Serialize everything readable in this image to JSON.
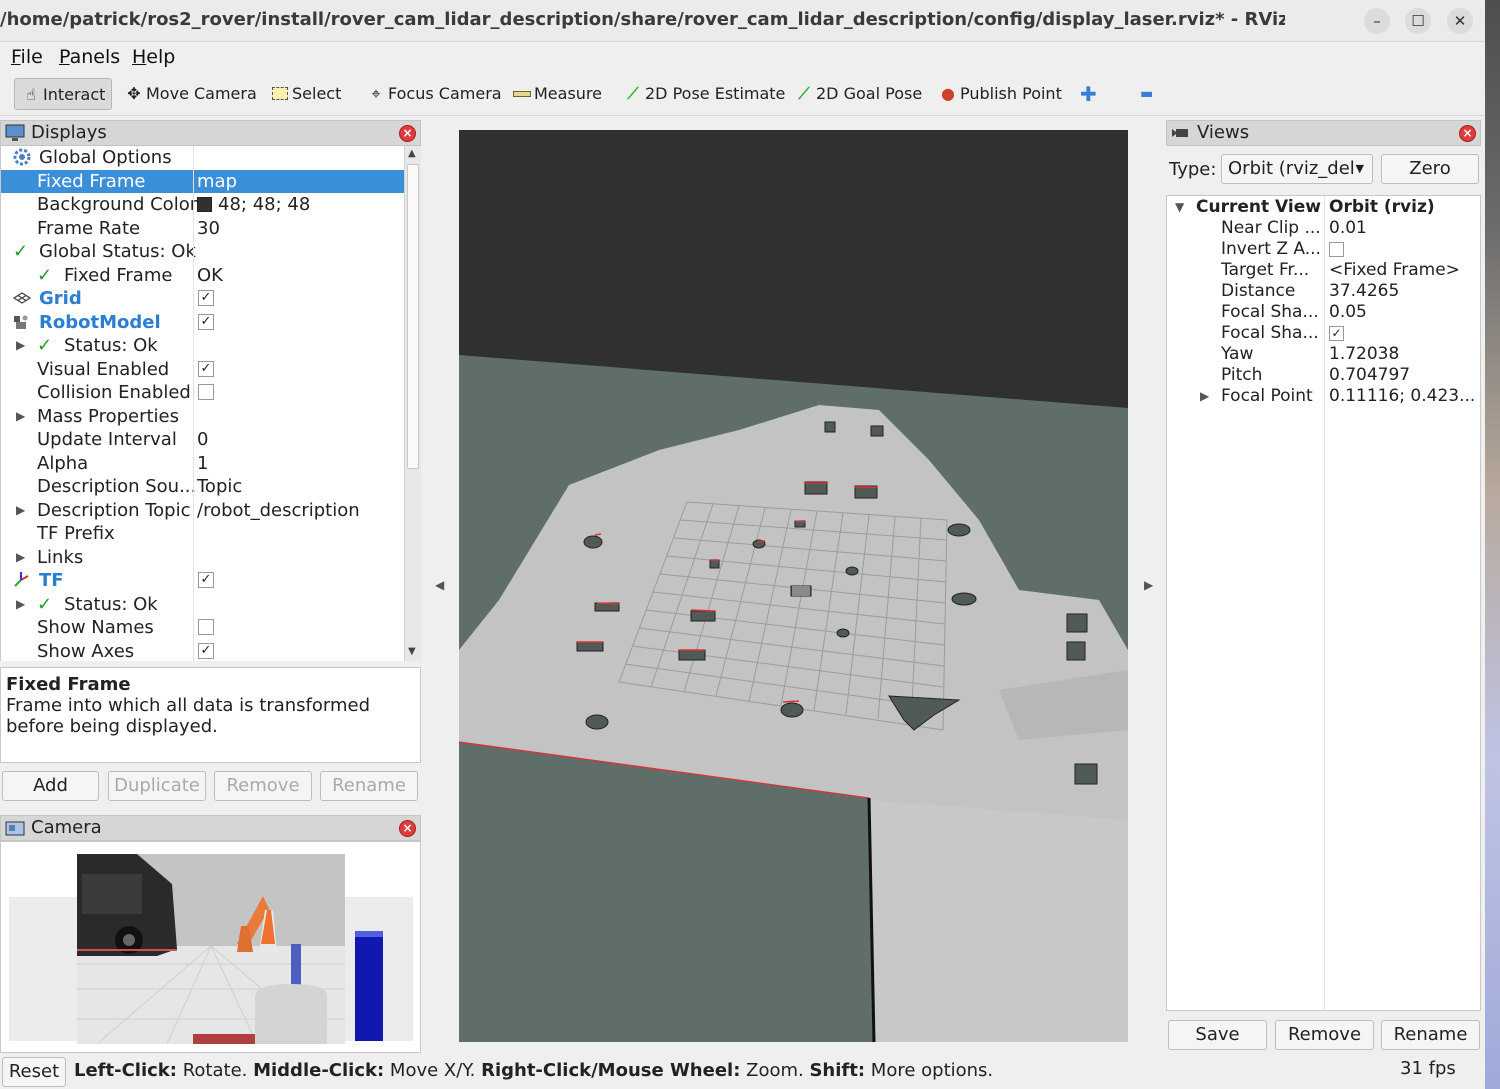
{
  "window": {
    "title": "/home/patrick/ros2_rover/install/rover_cam_lidar_description/share/rover_cam_lidar_description/config/display_laser.rviz* - RViz",
    "minimize_glyph": "–",
    "maximize_glyph": "☐",
    "close_glyph": "✕"
  },
  "menubar": {
    "file": {
      "first": "F",
      "rest": "ile"
    },
    "panels": {
      "first": "P",
      "rest": "anels"
    },
    "help": {
      "first": "H",
      "rest": "elp"
    }
  },
  "toolbar": {
    "interact": "Interact",
    "move_camera": "Move Camera",
    "select": "Select",
    "focus_camera": "Focus Camera",
    "measure": "Measure",
    "pose_estimate": "2D Pose Estimate",
    "goal_pose": "2D Goal Pose",
    "publish_point": "Publish Point",
    "add_tool_glyph": "✚",
    "remove_tool_glyph": "▬"
  },
  "displays": {
    "title": "Displays",
    "rows": [
      {
        "label": "Global Options"
      },
      {
        "label": "Fixed Frame",
        "value": "map"
      },
      {
        "label": "Background Color",
        "value": "48; 48; 48"
      },
      {
        "label": "Frame Rate",
        "value": "30"
      },
      {
        "label": "Global Status: Ok"
      },
      {
        "label": "Fixed Frame",
        "value": "OK"
      },
      {
        "label": "Grid",
        "checked": true
      },
      {
        "label": "RobotModel",
        "checked": true
      },
      {
        "label": "Status: Ok"
      },
      {
        "label": "Visual Enabled",
        "checked": true
      },
      {
        "label": "Collision Enabled",
        "checked": false
      },
      {
        "label": "Mass Properties"
      },
      {
        "label": "Update Interval",
        "value": "0"
      },
      {
        "label": "Alpha",
        "value": "1"
      },
      {
        "label": "Description Sou...",
        "value": "Topic"
      },
      {
        "label": "Description Topic",
        "value": "/robot_description"
      },
      {
        "label": "TF Prefix"
      },
      {
        "label": "Links"
      },
      {
        "label": "TF",
        "checked": true
      },
      {
        "label": "Status: Ok"
      },
      {
        "label": "Show Names",
        "checked": false
      },
      {
        "label": "Show Axes",
        "checked": true
      }
    ],
    "check_glyph": "✓",
    "status_check": "✓"
  },
  "description": {
    "title": "Fixed Frame",
    "text": "Frame into which all data is transformed before being displayed."
  },
  "display_buttons": {
    "add": "Add",
    "duplicate": "Duplicate",
    "remove": "Remove",
    "rename": "Rename"
  },
  "camera": {
    "title": "Camera"
  },
  "views": {
    "title": "Views",
    "type_label": "Type:",
    "type_value": "Orbit (rviz_del",
    "zero": "Zero",
    "current_view": {
      "label": "Current View",
      "value": "Orbit (rviz)"
    },
    "props": [
      {
        "label": "Near Clip ...",
        "value": "0.01"
      },
      {
        "label": "Invert Z A...",
        "checked": false
      },
      {
        "label": "Target Fr...",
        "value": "<Fixed Frame>"
      },
      {
        "label": "Distance",
        "value": "37.4265"
      },
      {
        "label": "Focal Sha...",
        "value": "0.05"
      },
      {
        "label": "Focal Sha...",
        "checked": true
      },
      {
        "label": "Yaw",
        "value": "1.72038"
      },
      {
        "label": "Pitch",
        "value": "0.704797"
      },
      {
        "label": "Focal Point",
        "value": "0.11116; 0.423..."
      }
    ],
    "save": "Save",
    "remove": "Remove",
    "rename": "Rename"
  },
  "statusbar": {
    "reset": "Reset",
    "hint_parts": [
      {
        "bold": "Left-Click:",
        "text": " Rotate. "
      },
      {
        "bold": "Middle-Click:",
        "text": " Move X/Y. "
      },
      {
        "bold": "Right-Click/Mouse Wheel:",
        "text": " Zoom. "
      },
      {
        "bold": "Shift:",
        "text": " More options."
      }
    ],
    "fps": "31 fps"
  },
  "colors": {
    "selection": "#3a8fd8",
    "background_3d": "#303030",
    "map_free": "#c8c8c8",
    "map_unknown": "#5f6f6a",
    "laser": "#e03030"
  }
}
